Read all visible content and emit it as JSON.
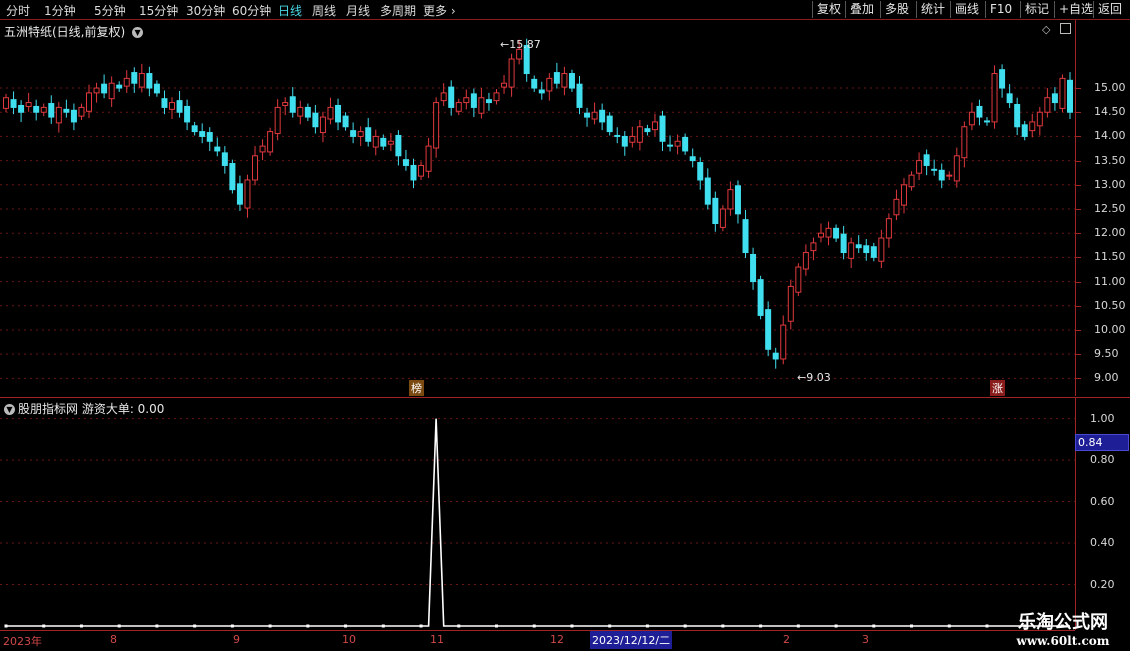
{
  "toolbar": {
    "timeframes": [
      "分时",
      "1分钟",
      "5分钟",
      "15分钟",
      "30分钟",
      "60分钟",
      "日线",
      "周线",
      "月线",
      "多周期",
      "更多"
    ],
    "active_timeframe": "日线",
    "buttons": [
      "复权",
      "叠加",
      "多股",
      "统计",
      "画线",
      "F10",
      "标记",
      "+自选",
      "返回"
    ]
  },
  "main": {
    "title": "五洲特纸(日线,前复权)",
    "high_label": "15.87",
    "low_label": "9.03",
    "badge_left": "榜",
    "badge_right": "涨"
  },
  "indicator": {
    "title": "股朋指标网  游资大单: 0.00",
    "current_value": "0.84"
  },
  "chart_data": [
    {
      "type": "candlestick",
      "title": "五洲特纸(日线,前复权)",
      "ylim": [
        8.8,
        16.2
      ],
      "yticks": [
        9.0,
        9.5,
        10.0,
        10.5,
        11.0,
        11.5,
        12.0,
        12.5,
        13.0,
        13.5,
        14.0,
        14.5,
        15.0
      ],
      "colors": {
        "up": "#e0393e",
        "down": "#40dfef"
      },
      "closes": [
        14.8,
        14.6,
        14.5,
        14.7,
        14.5,
        14.6,
        14.4,
        14.6,
        14.5,
        14.3,
        14.6,
        14.9,
        15.0,
        14.9,
        15.1,
        15.0,
        15.2,
        15.1,
        15.3,
        15.0,
        14.9,
        14.6,
        14.7,
        14.5,
        14.3,
        14.1,
        14.0,
        13.9,
        13.7,
        13.4,
        12.9,
        12.6,
        13.1,
        13.6,
        13.8,
        14.1,
        14.6,
        14.7,
        14.5,
        14.6,
        14.4,
        14.2,
        14.4,
        14.6,
        14.3,
        14.2,
        14.0,
        14.1,
        13.9,
        14.0,
        13.8,
        13.9,
        13.6,
        13.4,
        13.1,
        13.4,
        13.8,
        14.7,
        14.9,
        14.6,
        14.7,
        14.8,
        14.6,
        14.8,
        14.7,
        14.9,
        15.1,
        15.6,
        15.8,
        15.3,
        15.0,
        14.9,
        15.2,
        15.1,
        15.3,
        15.0,
        14.6,
        14.4,
        14.5,
        14.3,
        14.1,
        14.0,
        13.8,
        14.0,
        14.2,
        14.1,
        14.3,
        13.9,
        13.8,
        13.9,
        13.7,
        13.5,
        13.1,
        12.6,
        12.2,
        12.5,
        12.9,
        12.4,
        11.6,
        11.0,
        10.3,
        9.6,
        9.4,
        10.1,
        10.9,
        11.3,
        11.6,
        11.8,
        12.0,
        12.1,
        11.9,
        11.6,
        11.8,
        11.7,
        11.6,
        11.5,
        11.9,
        12.3,
        12.7,
        13.0,
        13.2,
        13.5,
        13.4,
        13.3,
        13.1,
        13.2,
        13.6,
        14.2,
        14.5,
        14.4,
        14.3,
        15.3,
        15.0,
        14.7,
        14.2,
        14.0,
        14.3,
        14.5,
        14.8,
        14.7,
        15.2,
        14.5
      ],
      "high_marker": 15.87,
      "low_marker": 9.03
    },
    {
      "type": "line",
      "title": "游资大单",
      "ylim": [
        0,
        1.08
      ],
      "yticks": [
        0.2,
        0.4,
        0.6,
        0.8,
        1.0
      ],
      "values_note_index": 57,
      "peak_value": 1.0,
      "baseline_value": 0.0
    }
  ],
  "date_axis": [
    "2023年",
    "8",
    "9",
    "10",
    "11",
    "12",
    "2023/12/12/二",
    "2",
    "3"
  ],
  "watermark": {
    "title": "乐淘公式网",
    "url": "www.60lt.com"
  }
}
